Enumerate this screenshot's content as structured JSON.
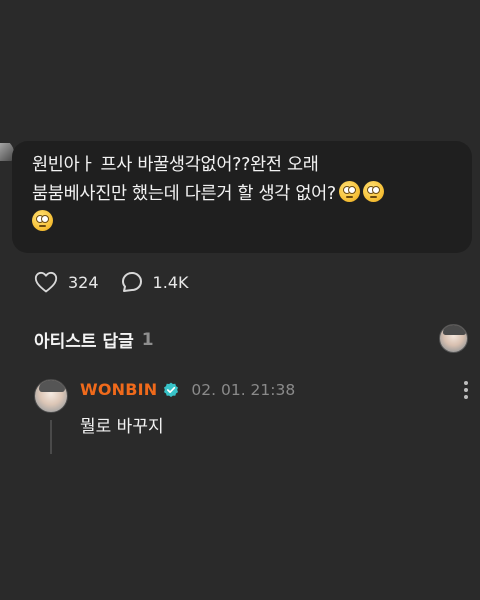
{
  "post": {
    "line1": "원빈아ㅏ 프사 바꿀생각없어??완전 오래",
    "line2": "붐붐베사진만 했는데 다른거 할 생각 없어?",
    "emoji_name": "eye-roll-emoji"
  },
  "actions": {
    "like_count": "324",
    "comment_count": "1.4K",
    "like_icon": "heart-icon",
    "comment_icon": "comment-bubble-icon"
  },
  "section": {
    "title": "아티스트 답글",
    "count": "1"
  },
  "comment": {
    "author": "WONBIN",
    "author_color": "#f06a1b",
    "verified_color": "#38c3c8",
    "time": "02. 01. 21:38",
    "body": "뭘로 바꾸지"
  }
}
